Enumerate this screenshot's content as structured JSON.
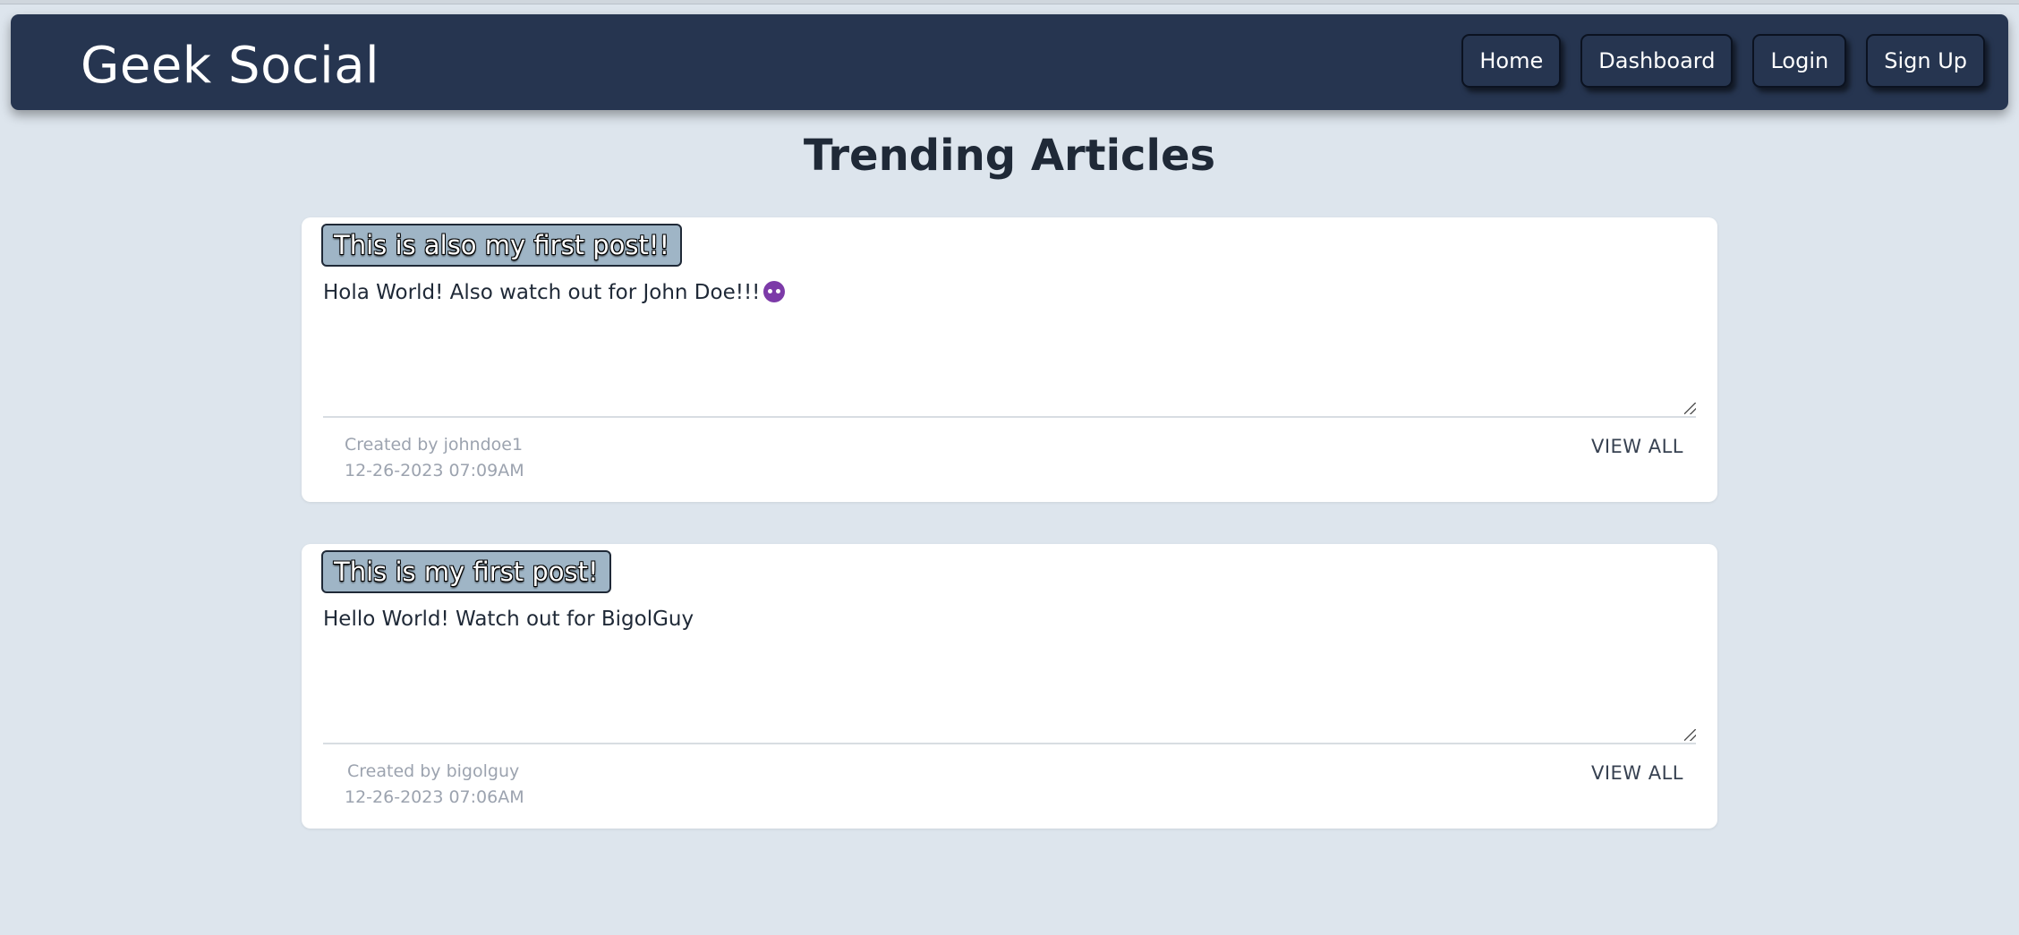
{
  "navbar": {
    "brand": "Geek Social",
    "links": [
      "Home",
      "Dashboard",
      "Login",
      "Sign Up"
    ]
  },
  "page": {
    "title": "Trending Articles"
  },
  "articles": [
    {
      "title": "This is also my first post!!",
      "body": "Hola World! Also watch out for John Doe!!!",
      "emoji_icon": "smiling-devil-icon",
      "author_line": "Created by johndoe1",
      "date": "12-26-2023 07:09AM",
      "action": "VIEW ALL"
    },
    {
      "title": "This is my first post!",
      "body": "Hello World! Watch out for BigolGuy",
      "author_line": "Created by bigolguy",
      "date": "12-26-2023 07:06AM",
      "action": "VIEW ALL"
    }
  ],
  "colors": {
    "page_background": "#dde5ed",
    "navbar_background": "#263550",
    "card_background": "#ffffff",
    "title_chip_background": "#9fb5c6"
  }
}
